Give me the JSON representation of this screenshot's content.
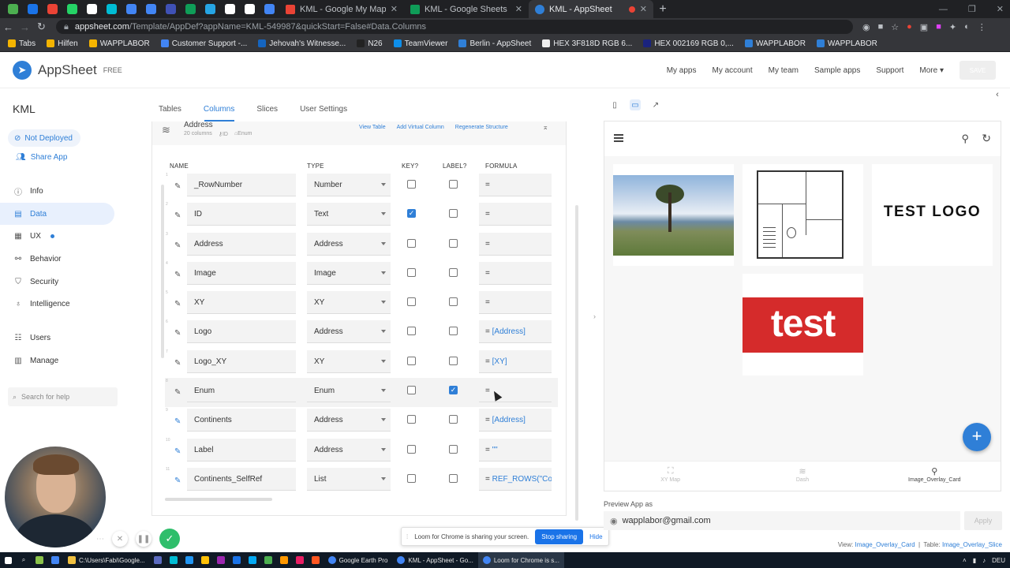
{
  "browser": {
    "pinned_tab_colors": [
      "#4caf50",
      "#1a73e8",
      "#ea4335",
      "#25d366",
      "#ffffff",
      "#00bcd4",
      "#4285f4",
      "#4285f4",
      "#3f51b5",
      "#0f9d58",
      "#26a5e4",
      "#ffffff",
      "#ffffff",
      "#4285f4"
    ],
    "tabs": [
      {
        "title": "KML - Google My Maps",
        "color": "#ea4335"
      },
      {
        "title": "KML - Google Sheets",
        "color": "#0f9d58"
      },
      {
        "title": "KML - AppSheet",
        "color": "#2f7fd7"
      }
    ],
    "new_tab": "+",
    "url_host": "appsheet.com",
    "url_path": "/Template/AppDef?appName=KML-549987&quickStart=False#Data.Columns",
    "bookmarks": [
      "Tabs",
      "Hilfen",
      "WAPPLABOR",
      "Customer Support -...",
      "Jehovah's Witnesse...",
      "N26",
      "TeamViewer",
      "Berlin - AppSheet",
      "HEX 3F818D RGB 6...",
      "HEX 002169 RGB 0,...",
      "WAPPLABOR",
      "WAPPLABOR"
    ]
  },
  "header": {
    "brand": "AppSheet",
    "brand_tag": "FREE",
    "nav": [
      "My apps",
      "My account",
      "My team",
      "Sample apps",
      "Support",
      "More"
    ],
    "save_label": "SAVE"
  },
  "sidebar": {
    "app_name": "KML",
    "deploy_status": "Not Deployed",
    "share_label": "Share App",
    "items": [
      {
        "label": "Info",
        "icon": "info-icon"
      },
      {
        "label": "Data",
        "icon": "data-icon",
        "active": true
      },
      {
        "label": "UX",
        "icon": "ux-icon"
      },
      {
        "label": "Behavior",
        "icon": "behavior-icon"
      },
      {
        "label": "Security",
        "icon": "security-icon"
      },
      {
        "label": "Intelligence",
        "icon": "intelligence-icon"
      },
      {
        "label": "Users",
        "icon": "users-icon"
      },
      {
        "label": "Manage",
        "icon": "manage-icon"
      }
    ],
    "search_placeholder": "Search for help"
  },
  "editor": {
    "subtabs": [
      "Tables",
      "Columns",
      "Slices",
      "User Settings"
    ],
    "active_subtab": "Columns",
    "table_name": "Address",
    "table_columns": "20 columns",
    "table_key": "ID",
    "table_label": "Enum",
    "actions": [
      "View Table",
      "Add Virtual Column",
      "Regenerate Structure"
    ],
    "headers": {
      "name": "NAME",
      "type": "TYPE",
      "key": "KEY?",
      "label": "LABEL?",
      "formula": "FORMULA"
    },
    "rows": [
      {
        "num": "1",
        "name": "_RowNumber",
        "type": "Number",
        "key": false,
        "label": false,
        "eq": "=",
        "formula": "",
        "virtual": false
      },
      {
        "num": "2",
        "name": "ID",
        "type": "Text",
        "key": true,
        "label": false,
        "eq": "=",
        "formula": "",
        "virtual": false
      },
      {
        "num": "3",
        "name": "Address",
        "type": "Address",
        "key": false,
        "label": false,
        "eq": "=",
        "formula": "",
        "virtual": false
      },
      {
        "num": "4",
        "name": "Image",
        "type": "Image",
        "key": false,
        "label": false,
        "eq": "=",
        "formula": "",
        "virtual": false
      },
      {
        "num": "5",
        "name": "XY",
        "type": "XY",
        "key": false,
        "label": false,
        "eq": "=",
        "formula": "",
        "virtual": false
      },
      {
        "num": "6",
        "name": "Logo",
        "type": "Address",
        "key": false,
        "label": false,
        "eq": "=",
        "formula": "[Address]",
        "virtual": false
      },
      {
        "num": "7",
        "name": "Logo_XY",
        "type": "XY",
        "key": false,
        "label": false,
        "eq": "=",
        "formula": "[XY]",
        "virtual": false
      },
      {
        "num": "8",
        "name": "Enum",
        "type": "Enum",
        "key": false,
        "label": true,
        "eq": "=",
        "formula": "",
        "virtual": false
      },
      {
        "num": "9",
        "name": "Continents",
        "type": "Address",
        "key": false,
        "label": false,
        "eq": "=",
        "formula": "[Address]",
        "virtual": true
      },
      {
        "num": "10",
        "name": "Label",
        "type": "Address",
        "key": false,
        "label": false,
        "eq": "=",
        "formula": "\"\"",
        "virtual": true
      },
      {
        "num": "11",
        "name": "Continents_SelfRef",
        "type": "List",
        "key": false,
        "label": false,
        "eq": "=",
        "formula": "REF_ROWS(\"Co",
        "virtual": true
      }
    ]
  },
  "loom": {
    "message": "Loom for Chrome is sharing your screen.",
    "stop_label": "Stop sharing",
    "hide_label": "Hide"
  },
  "preview": {
    "logo_text": "TEST LOGO",
    "red_logo_text": "test",
    "fab": "+",
    "bottom_nav": [
      {
        "label": "XY Map",
        "active": false
      },
      {
        "label": "Dash",
        "active": false
      },
      {
        "label": "Image_Overlay_Card",
        "active": true
      }
    ],
    "preview_as_label": "Preview App as",
    "user_email": "wapplabor@gmail.com",
    "apply_label": "Apply",
    "view_label": "View:",
    "view_value": "Image_Overlay_Card",
    "table_label": "Table:",
    "table_value": "Image_Overlay_Slice"
  },
  "taskbar": {
    "items": [
      {
        "label": "C:\\Users\\Fabi\\Google...",
        "color": "#f0c040"
      },
      {
        "label": "Google Earth Pro",
        "color": "#4285f4"
      },
      {
        "label": "KML - AppSheet - Go...",
        "color": "#4285f4"
      },
      {
        "label": "Loom for Chrome is s...",
        "color": "#4285f4"
      }
    ],
    "lang": "DEU"
  }
}
